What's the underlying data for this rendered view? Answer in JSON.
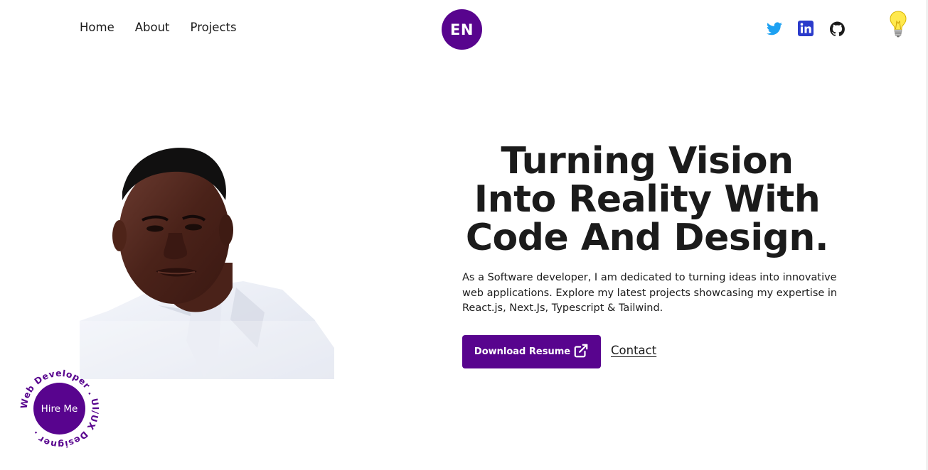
{
  "nav": {
    "items": [
      {
        "label": "Home"
      },
      {
        "label": "About"
      },
      {
        "label": "Projects"
      }
    ]
  },
  "logo": {
    "text": "EN",
    "color": "#58048e"
  },
  "socials": [
    {
      "icon": "twitter-icon",
      "color": "#1da1f2"
    },
    {
      "icon": "linkedin-icon",
      "color": "#2b3bcb"
    },
    {
      "icon": "github-icon",
      "color": "#1b1b1b"
    }
  ],
  "theme_toggle": {
    "icon": "lightbulb-icon"
  },
  "hero": {
    "headline_lines": [
      "Turning Vision",
      "Into Reality With",
      "Code And Design."
    ],
    "description": "As a Software developer, I am dedicated to turning ideas into innovative web applications. Explore my latest projects showcasing my expertise in React.js, Next.Js, Typescript & Tailwind.",
    "resume_button": "Download Resume",
    "contact_link": "Contact"
  },
  "hire_me": {
    "label": "Hire Me",
    "ring_text": "Web Developer . UI/UX Designer . "
  },
  "colors": {
    "accent": "#58048e",
    "text": "#1b1b1b",
    "background": "#ffffff"
  }
}
